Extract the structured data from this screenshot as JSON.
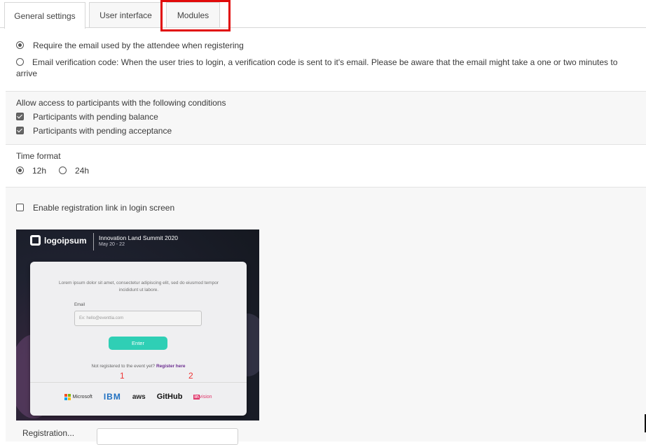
{
  "tabs": [
    {
      "label": "General settings",
      "active": true
    },
    {
      "label": "User interface",
      "active": false
    },
    {
      "label": "Modules",
      "active": false
    }
  ],
  "login_method": {
    "option_require_email": "Require the email used by the attendee when registering",
    "option_verification_code": "Email verification code: When the user tries to login, a verification code is sent to it's email. Please be aware that the email might take a one or two minutes to arrive",
    "selected": "require_email"
  },
  "access": {
    "title": "Allow access to participants with the following conditions",
    "pending_balance": {
      "label": "Participants with pending balance",
      "checked": true
    },
    "pending_acceptance": {
      "label": "Participants with pending acceptance",
      "checked": true
    }
  },
  "time_format": {
    "title": "Time format",
    "option_12h": "12h",
    "option_24h": "24h",
    "selected": "12h"
  },
  "registration_link": {
    "label": "Enable registration link in login screen",
    "checked": false
  },
  "preview": {
    "logo_text": "logoipsum",
    "event_title": "Innovation Land Summit 2020",
    "event_dates": "May 20 - 22",
    "lorem": "Lorem ipsum dolor sit amet, consectetur adipiscing elit, sed do eiusmod tempor incididunt ut labore.",
    "email_label": "Email",
    "email_placeholder": "Ex: hello@eventtia.com",
    "enter_button": "Enter",
    "not_registered": "Not registered to the event yet?",
    "register_here": "Register here",
    "marker_1": "1",
    "marker_2": "2",
    "sponsors": {
      "microsoft": "Microsoft",
      "ibm": "IBM",
      "aws": "aws",
      "github": "GitHub",
      "invision_in": "in",
      "invision_rest": "vision"
    }
  },
  "registration_label_cut": "Registration...",
  "colors": {
    "highlight": "#e10a0a",
    "accent": "#2fcfb5",
    "link": "#6a2b8f"
  }
}
